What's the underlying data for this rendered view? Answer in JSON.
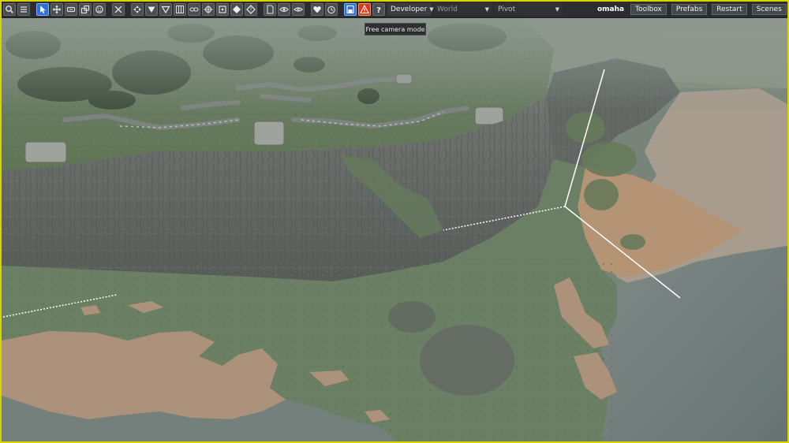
{
  "toolbar": {
    "left_buttons": [
      {
        "name": "search-icon"
      },
      {
        "name": "menu-icon"
      },
      {
        "name": "select-tool-icon",
        "active": true
      },
      {
        "name": "move-tool-icon"
      },
      {
        "name": "rotate-tool-icon"
      },
      {
        "name": "scale-tool-icon"
      },
      {
        "name": "snap-tool-icon"
      },
      {
        "name": "cut-icon"
      },
      {
        "name": "transform-gizmo-icon"
      },
      {
        "name": "drop-down-arrow-icon"
      },
      {
        "name": "drop-arrow-outline-icon"
      },
      {
        "name": "grid-icon"
      },
      {
        "name": "link-icon"
      },
      {
        "name": "target-icon"
      },
      {
        "name": "bounds-icon"
      },
      {
        "name": "diamond-icon"
      },
      {
        "name": "tag-icon"
      },
      {
        "name": "page-icon"
      },
      {
        "name": "eye-icon"
      },
      {
        "name": "eye-alt-icon"
      },
      {
        "name": "heart-icon"
      },
      {
        "name": "timer-icon"
      },
      {
        "name": "camera-mode-icon",
        "active": true
      },
      {
        "name": "warning-icon",
        "warn": true
      },
      {
        "name": "help-icon"
      }
    ],
    "developer_label": "Developer",
    "world_label": "World",
    "pivot_label": "Pivot",
    "scene_name": "omaha",
    "toolbox_label": "Toolbox",
    "prefabs_label": "Prefabs",
    "restart_label": "Restart",
    "scenes_label": "Scenes",
    "wrench_icon": "wrench-icon",
    "close_icon": "close-icon"
  },
  "tooltip": {
    "text": "Free camera mode"
  },
  "colors": {
    "frame_border": "#d8d400",
    "toolbar_bg": "#2b2d2e",
    "active_button": "#2f6fd2",
    "warning_button": "#d83a1c",
    "sand": "#b09074",
    "cliff": "#5c5f5b",
    "grass": "#5f7a52",
    "water": "#6e7a7a"
  }
}
